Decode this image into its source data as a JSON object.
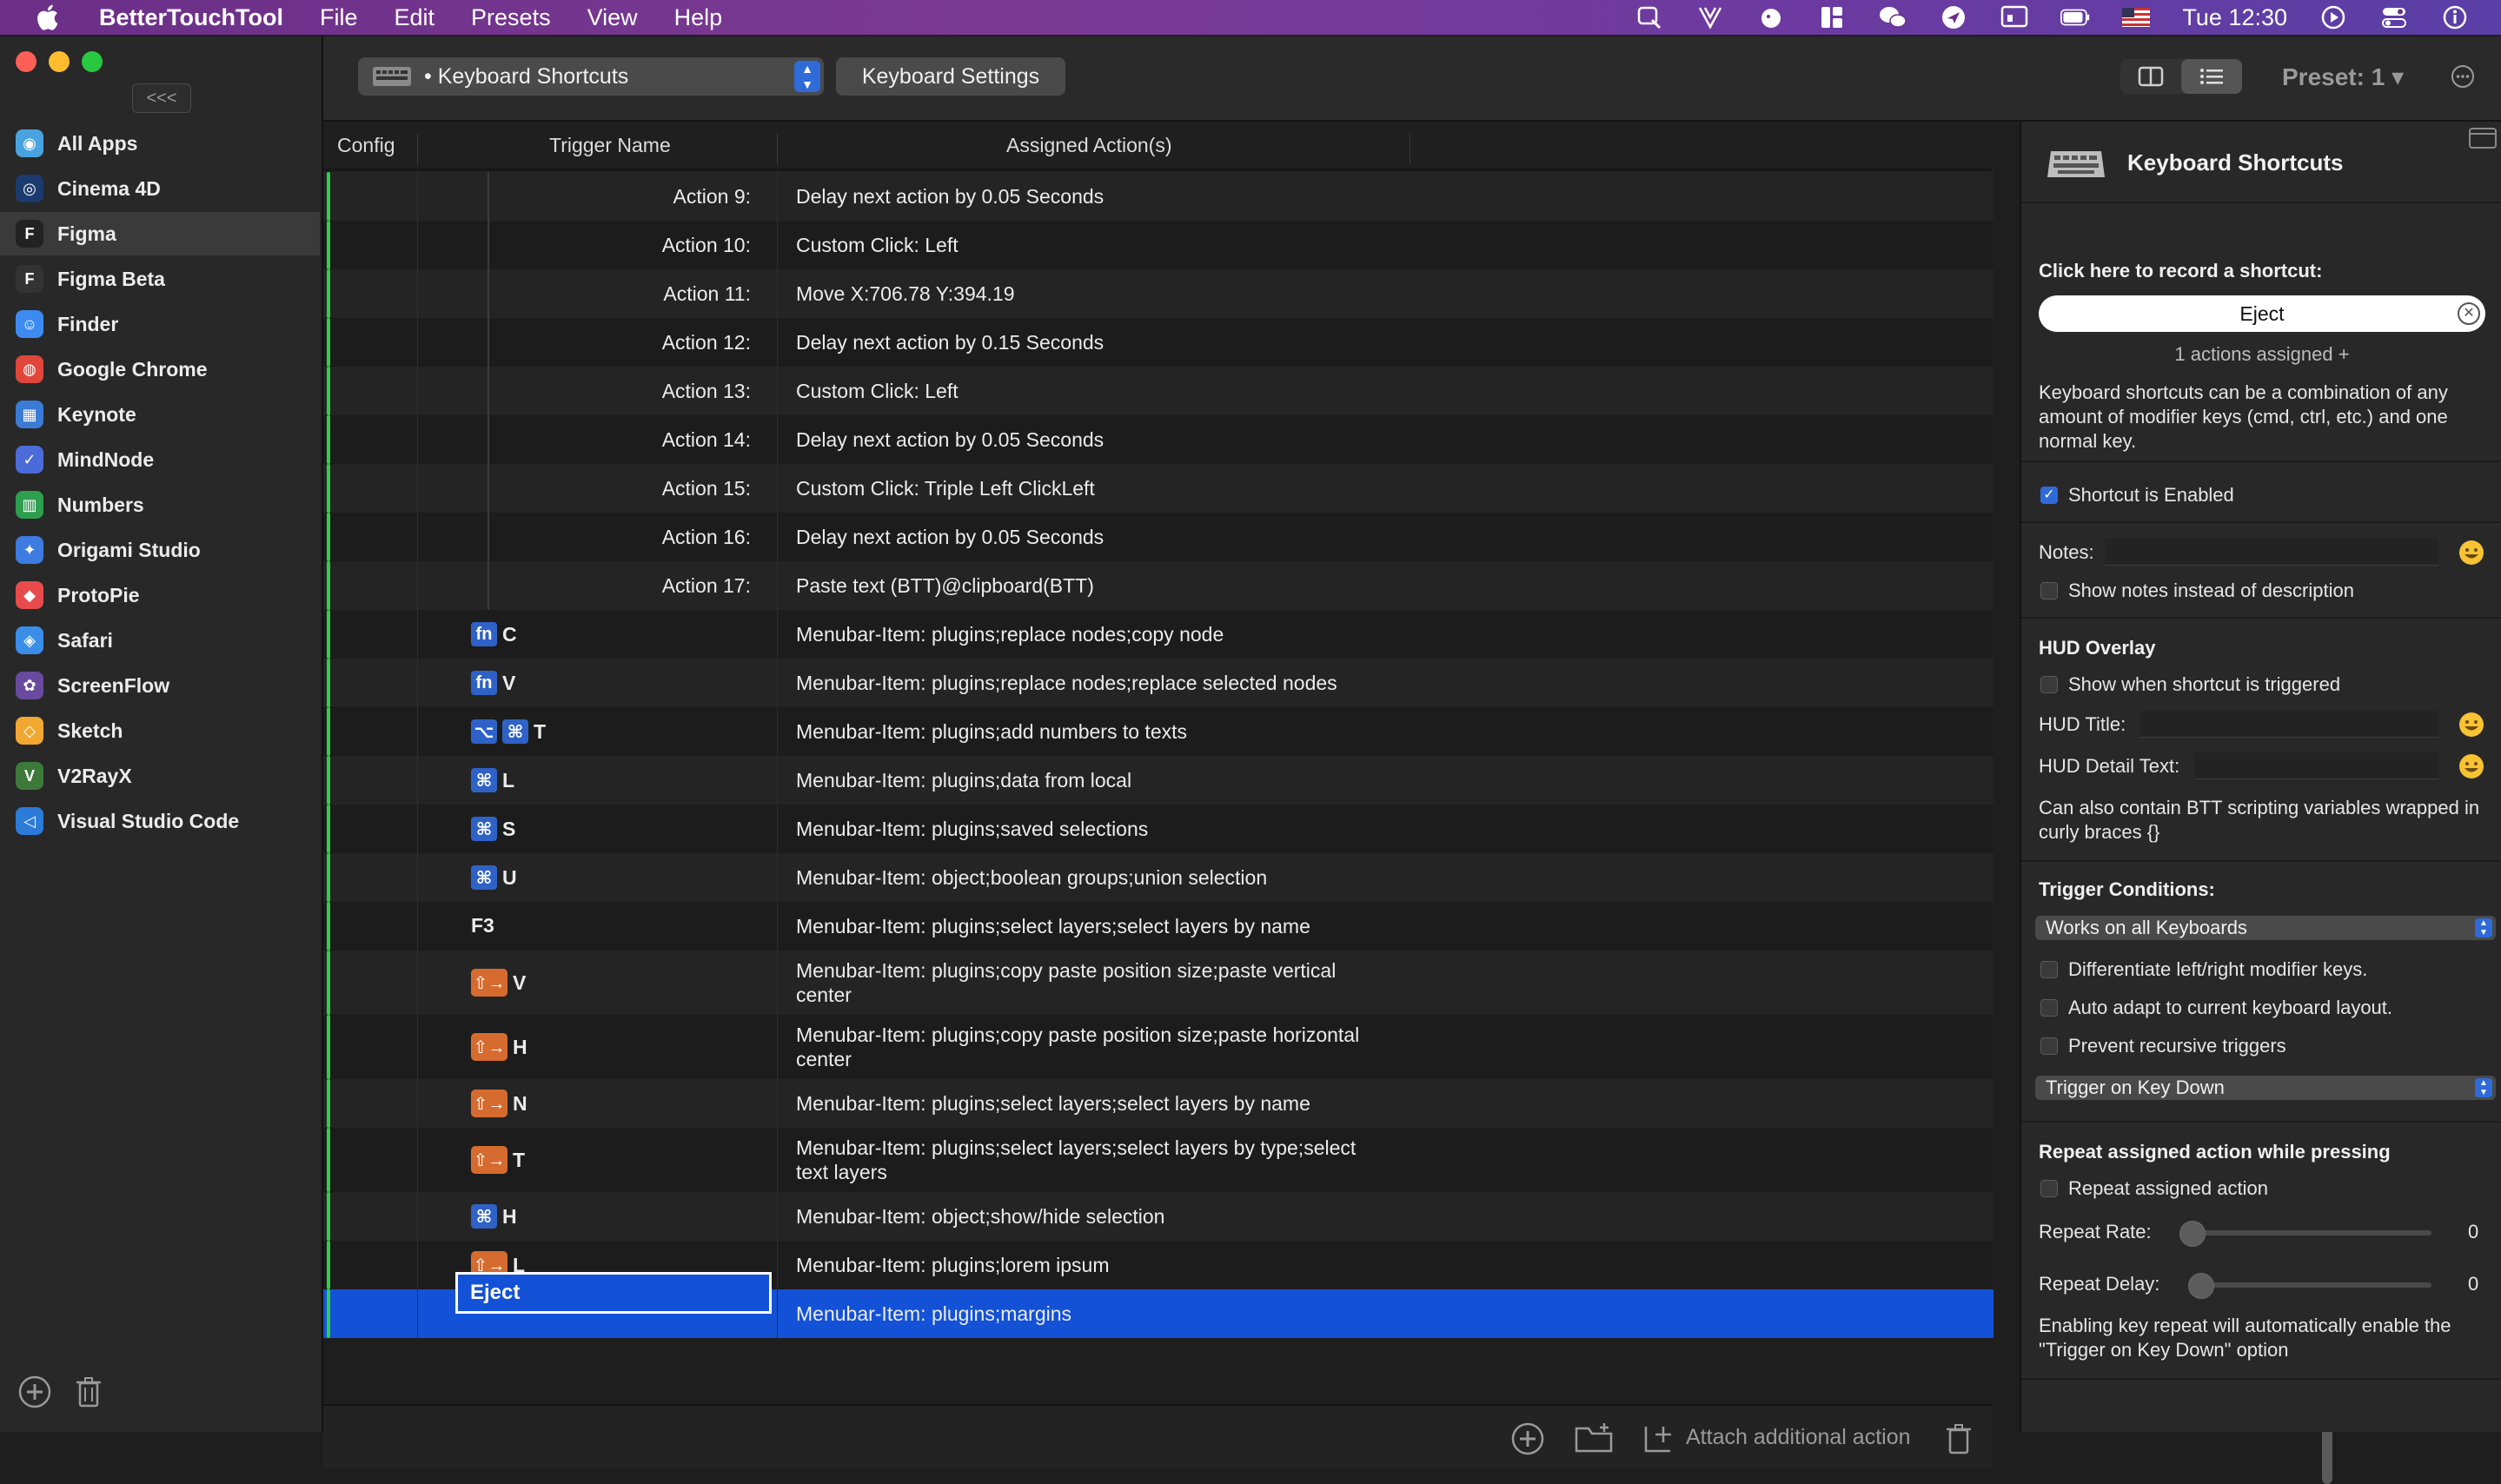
{
  "menubar": {
    "app_name": "BetterTouchTool",
    "menus": [
      "File",
      "Edit",
      "Presets",
      "View",
      "Help"
    ],
    "clock": "Tue 12:30",
    "status_icons": [
      "search-icon",
      "v2ray-icon",
      "bear-icon",
      "grid-icon",
      "wechat-icon",
      "spark-icon",
      "screen-icon",
      "battery-icon",
      "us-flag-icon",
      "play-icon",
      "control-center-icon",
      "info-icon"
    ]
  },
  "sidebar": {
    "collapse_label": "<<<",
    "apps": [
      {
        "label": "All Apps",
        "color": "#4aa3df",
        "glyph": "◉"
      },
      {
        "label": "Cinema 4D",
        "color": "#1b3a6d",
        "glyph": "◎"
      },
      {
        "label": "Figma",
        "color": "#222222",
        "glyph": "F",
        "selected": true
      },
      {
        "label": "Figma Beta",
        "color": "#333333",
        "glyph": "F"
      },
      {
        "label": "Finder",
        "color": "#3d8bf2",
        "glyph": "☺"
      },
      {
        "label": "Google Chrome",
        "color": "#e0463a",
        "glyph": "◍"
      },
      {
        "label": "Keynote",
        "color": "#3a7bd5",
        "glyph": "▦"
      },
      {
        "label": "MindNode",
        "color": "#4a6bd8",
        "glyph": "✓"
      },
      {
        "label": "Numbers",
        "color": "#2e9e4f",
        "glyph": "▥"
      },
      {
        "label": "Origami Studio",
        "color": "#3d7be0",
        "glyph": "✦"
      },
      {
        "label": "ProtoPie",
        "color": "#e84b4b",
        "glyph": "◆"
      },
      {
        "label": "Safari",
        "color": "#3a8ee8",
        "glyph": "◈"
      },
      {
        "label": "ScreenFlow",
        "color": "#6a4a9e",
        "glyph": "✿"
      },
      {
        "label": "Sketch",
        "color": "#f0a830",
        "glyph": "◇"
      },
      {
        "label": "V2RayX",
        "color": "#3d7a3a",
        "glyph": "V"
      },
      {
        "label": "Visual Studio Code",
        "color": "#2d7bd8",
        "glyph": "◁"
      }
    ]
  },
  "toolbar": {
    "trigger_type": "• Keyboard Shortcuts",
    "settings_button": "Keyboard Settings",
    "preset": "Preset: 1 ▾"
  },
  "table": {
    "headers": {
      "config": "Config",
      "trigger": "Trigger Name",
      "actions": "Assigned Action(s)"
    },
    "rows": [
      {
        "kind": "child",
        "trigger": "Action 9:",
        "action": "Delay next action by 0.05 Seconds"
      },
      {
        "kind": "child",
        "trigger": "Action 10:",
        "action": "Custom Click: Left"
      },
      {
        "kind": "child",
        "trigger": "Action 11:",
        "action": "Move X:706.78 Y:394.19"
      },
      {
        "kind": "child",
        "trigger": "Action 12:",
        "action": "Delay next action by 0.15 Seconds"
      },
      {
        "kind": "child",
        "trigger": "Action 13:",
        "action": "Custom Click: Left"
      },
      {
        "kind": "child",
        "trigger": "Action 14:",
        "action": "Delay next action by 0.05 Seconds"
      },
      {
        "kind": "child",
        "trigger": "Action 15:",
        "action": "Custom Click: Triple Left ClickLeft"
      },
      {
        "kind": "child",
        "trigger": "Action 16:",
        "action": "Delay next action by 0.05 Seconds"
      },
      {
        "kind": "child",
        "trigger": "Action 17:",
        "action": "Paste text (BTT)@clipboard(BTT)"
      },
      {
        "kind": "key",
        "mods": [
          "fn"
        ],
        "key": "C",
        "action": "Menubar-Item: plugins;replace nodes;copy node"
      },
      {
        "kind": "key",
        "mods": [
          "fn"
        ],
        "key": "V",
        "action": "Menubar-Item: plugins;replace nodes;replace selected nodes"
      },
      {
        "kind": "key",
        "mods": [
          "⌥",
          "⌘"
        ],
        "key": "T",
        "action": "Menubar-Item: plugins;add numbers to texts"
      },
      {
        "kind": "key",
        "mods": [
          "⌘"
        ],
        "key": "L",
        "action": "Menubar-Item: plugins;data from local"
      },
      {
        "kind": "key",
        "mods": [
          "⌘"
        ],
        "key": "S",
        "action": "Menubar-Item: plugins;saved selections"
      },
      {
        "kind": "key",
        "mods": [
          "⌘"
        ],
        "key": "U",
        "action": "Menubar-Item: object;boolean groups;union selection"
      },
      {
        "kind": "key",
        "mods": [],
        "key": "F3",
        "action": "Menubar-Item: plugins;select layers;select layers by name"
      },
      {
        "kind": "hyper",
        "key": "V",
        "action": "Menubar-Item: plugins;copy paste position size;paste vertical center",
        "tall": true
      },
      {
        "kind": "hyper",
        "key": "H",
        "action": "Menubar-Item: plugins;copy paste position size;paste horizontal center",
        "tall": true
      },
      {
        "kind": "hyper",
        "key": "N",
        "action": "Menubar-Item: plugins;select layers;select layers by name"
      },
      {
        "kind": "hyper",
        "key": "T",
        "action": "Menubar-Item: plugins;select layers;select layers by type;select text layers",
        "tall": true
      },
      {
        "kind": "key",
        "mods": [
          "⌘"
        ],
        "key": "H",
        "action": "Menubar-Item: object;show/hide selection"
      },
      {
        "kind": "hyper",
        "key": "L",
        "action": "Menubar-Item: plugins;lorem ipsum"
      },
      {
        "kind": "edit",
        "key": "Eject",
        "action": "Menubar-Item: plugins;margins",
        "selected": true
      }
    ],
    "hyper_glyph": "⇧→"
  },
  "footer": {
    "attach_label": "Attach additional action"
  },
  "panel": {
    "title": "Keyboard Shortcuts",
    "record_label": "Click here to record a shortcut:",
    "shortcut_value": "Eject",
    "actions_assigned": "1 actions assigned +",
    "description": "Keyboard shortcuts can be a combination of any amount of modifier keys (cmd, ctrl, etc.) and one normal key.",
    "enabled_label": "Shortcut is Enabled",
    "notes_label": "Notes:",
    "show_notes_label": "Show notes instead of description",
    "hud_heading": "HUD Overlay",
    "hud_show_label": "Show when shortcut is triggered",
    "hud_title_label": "HUD Title:",
    "hud_detail_label": "HUD Detail Text:",
    "hud_hint": "Can also contain BTT scripting variables wrapped in curly braces {}",
    "conditions_heading": "Trigger Conditions:",
    "keyboards_select": "Works on all Keyboards",
    "differentiate_label": "Differentiate left/right modifier keys.",
    "auto_adapt_label": "Auto adapt to current keyboard layout.",
    "prevent_label": "Prevent recursive triggers",
    "trigger_select": "Trigger on Key Down",
    "repeat_heading": "Repeat assigned action while pressing",
    "repeat_label": "Repeat assigned action",
    "repeat_rate_label": "Repeat Rate:",
    "repeat_rate_value": "0",
    "repeat_delay_label": "Repeat Delay:",
    "repeat_delay_value": "0",
    "repeat_hint": "Enabling key repeat will automatically enable the \"Trigger on Key Down\" option"
  }
}
